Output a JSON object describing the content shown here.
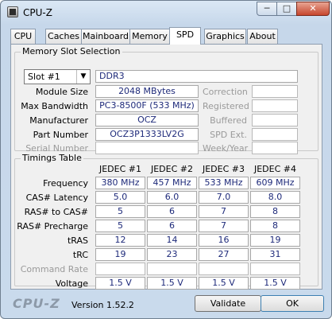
{
  "window": {
    "title": "CPU-Z",
    "min_label": "─",
    "max_label": "□",
    "close_label": "✕"
  },
  "tabs": [
    {
      "label": "CPU"
    },
    {
      "label": "Caches"
    },
    {
      "label": "Mainboard"
    },
    {
      "label": "Memory"
    },
    {
      "label": "SPD"
    },
    {
      "label": "Graphics"
    },
    {
      "label": "About"
    }
  ],
  "active_tab": "SPD",
  "memory_slot": {
    "group_title": "Memory Slot Selection",
    "slot_selected": "Slot #1",
    "type": "DDR3",
    "labels": {
      "module_size": "Module Size",
      "max_bandwidth": "Max Bandwidth",
      "manufacturer": "Manufacturer",
      "part_number": "Part Number",
      "serial_number": "Serial Number",
      "correction": "Correction",
      "registered": "Registered",
      "buffered": "Buffered",
      "spd_ext": "SPD Ext.",
      "week_year": "Week/Year"
    },
    "values": {
      "module_size": "2048 MBytes",
      "max_bandwidth": "PC3-8500F (533 MHz)",
      "manufacturer": "OCZ",
      "part_number": "OCZ3P1333LV2G",
      "serial_number": ""
    }
  },
  "timings": {
    "group_title": "Timings Table",
    "columns": [
      "JEDEC #1",
      "JEDEC #2",
      "JEDEC #3",
      "JEDEC #4"
    ],
    "rows": [
      {
        "label": "Frequency",
        "values": [
          "380 MHz",
          "457 MHz",
          "533 MHz",
          "609 MHz"
        ]
      },
      {
        "label": "CAS# Latency",
        "values": [
          "5.0",
          "6.0",
          "7.0",
          "8.0"
        ]
      },
      {
        "label": "RAS# to CAS#",
        "values": [
          "5",
          "6",
          "7",
          "8"
        ]
      },
      {
        "label": "RAS# Precharge",
        "values": [
          "5",
          "6",
          "7",
          "8"
        ]
      },
      {
        "label": "tRAS",
        "values": [
          "12",
          "14",
          "16",
          "19"
        ]
      },
      {
        "label": "tRC",
        "values": [
          "19",
          "23",
          "27",
          "31"
        ]
      },
      {
        "label": "Command Rate",
        "values": [
          "",
          "",
          "",
          ""
        ],
        "dim": true
      },
      {
        "label": "Voltage",
        "values": [
          "1.5 V",
          "1.5 V",
          "1.5 V",
          "1.5 V"
        ]
      }
    ]
  },
  "footer": {
    "logo": "CPU-Z",
    "version": "Version 1.52.2",
    "validate_label": "Validate",
    "ok_label": "OK"
  }
}
